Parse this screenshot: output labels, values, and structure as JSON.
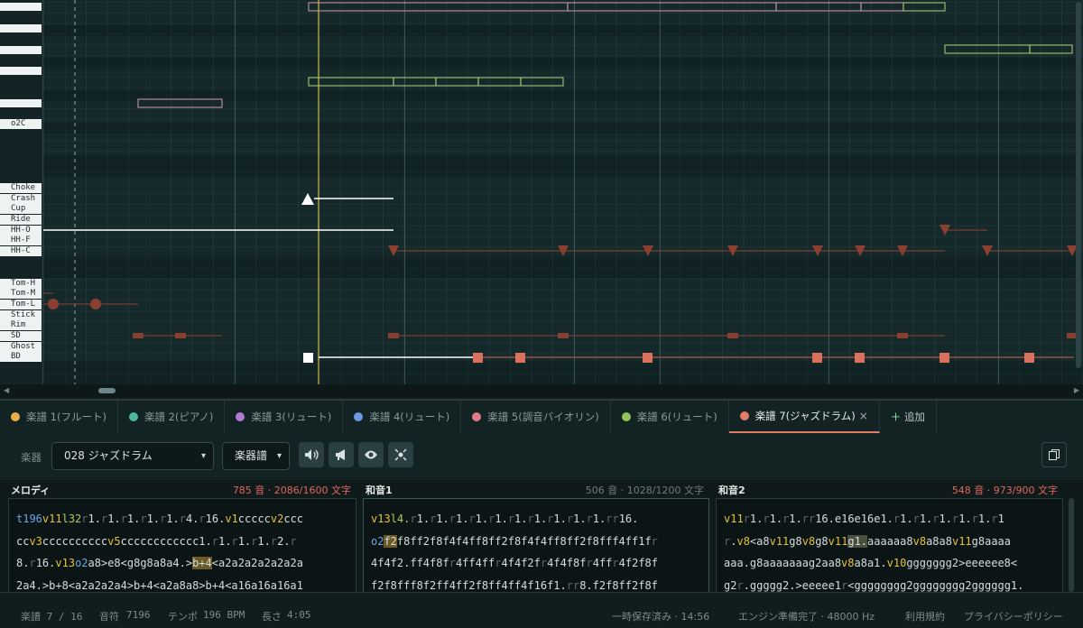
{
  "piano_roll": {
    "octave_label": "o2C",
    "drum_lanes": [
      "Choke",
      "Crash",
      "Cup",
      "Ride",
      "HH-O",
      "HH-F",
      "HH-C",
      "Tom-H",
      "Tom-M",
      "Tom-L",
      "Stick",
      "Rim",
      "SD",
      "Ghost",
      "BD"
    ]
  },
  "tabs": [
    {
      "label": "楽譜 1(フルート)",
      "color": "#e8b04a",
      "active": false
    },
    {
      "label": "楽譜 2(ピアノ)",
      "color": "#4fb8a0",
      "active": false
    },
    {
      "label": "楽譜 3(リュート)",
      "color": "#b07ad0",
      "active": false
    },
    {
      "label": "楽譜 4(リュート)",
      "color": "#6a9ae0",
      "active": false
    },
    {
      "label": "楽譜 5(調音バイオリン)",
      "color": "#e07a8a",
      "active": false
    },
    {
      "label": "楽譜 6(リュート)",
      "color": "#94c25a",
      "active": false
    },
    {
      "label": "楽譜 7(ジャズドラム)",
      "color": "#e27d6a",
      "active": true
    }
  ],
  "tab_close": "×",
  "add_tab": "追加",
  "toolbar": {
    "instrument_label": "楽器",
    "instrument_value": "028 ジャズドラム",
    "mode_value": "楽器譜"
  },
  "panes": {
    "melody": {
      "title": "メロディ",
      "stats": "785 音 · 2086/1600 文字",
      "lines": [
        "t196v11l32r1.r1.r1.r1.r1.r4.r16.v1cccccv2ccc",
        "ccv3ccccccccccv5cccccccccccc1.r1.r1.r1.r2.r",
        "8.r16.v13o2a8>e8<g8g8a8a4.>b+4<a2a2a2a2a2a2a",
        "2a4.>b+8<a2a2a2a4>b+4<a2a8a8>b+4<a16a16a16a1"
      ]
    },
    "chord1": {
      "title": "和音1",
      "stats": "506 音 · 1028/1200 文字",
      "lines": [
        "v13l4.r1.r1.r1.r1.r1.r1.r1.r1.r1.r1.rr16.",
        "o2f2f8ff2f8f4f4ff8ff2f8f4f4ff8ff2f8fff4ff1fr",
        "4f4f2.ff4f8fr4ff4ffr4f4f2fr4f4f8fr4ffr4f2f8f",
        "f2f8fff8f2ff4ff2f8ff4ff4f16f1.rr8.f2f8ff2f8f"
      ]
    },
    "chord2": {
      "title": "和音2",
      "stats": "548 音 · 973/900 文字",
      "lines": [
        "v11r1.r1.r1.rr16.e16e16e1.r1.r1.r1.r1.r1.r1",
        "r.v8<a8v11g8v8g8v11g1.aaaaaa8v8a8a8v11g8aaaa",
        "aaa.g8aaaaaaag2aa8v8a8a1.v10ggggggg2>eeeeee8<",
        "g2r.ggggg2.>eeeee1r<gggggggg2gggggggg2gggggg1."
      ]
    }
  },
  "status": {
    "score": "楽譜 7 / 16",
    "notes_label": "音符",
    "notes": "7196",
    "tempo_label": "テンポ",
    "tempo": "196 BPM",
    "length_label": "長さ",
    "length": "4:05",
    "saved": "一時保存済み · 14:56",
    "engine": "エンジン準備完了 · 48000 Hz",
    "terms": "利用規約",
    "privacy": "プライバシーポリシー"
  }
}
